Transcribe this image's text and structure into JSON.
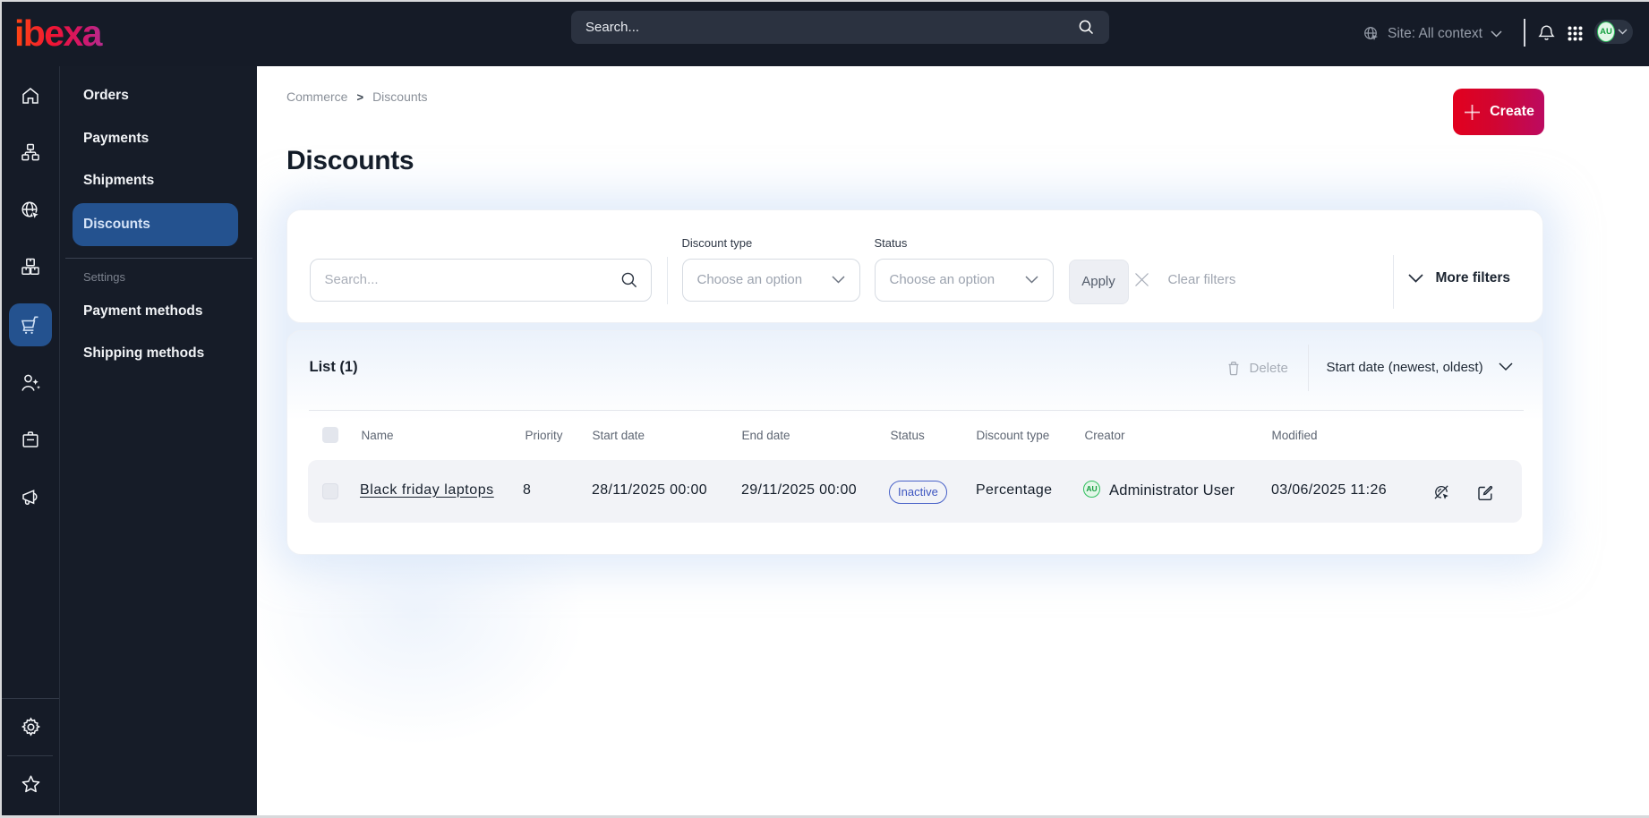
{
  "topbar": {
    "logo_text": "ibexa",
    "search_placeholder": "Search...",
    "site_context_label": "Site: All context",
    "avatar_initials": "AU"
  },
  "icon_rail": {
    "items": [
      {
        "name": "dashboard"
      },
      {
        "name": "content"
      },
      {
        "name": "site"
      },
      {
        "name": "products"
      },
      {
        "name": "commerce",
        "active": true
      },
      {
        "name": "customers"
      },
      {
        "name": "corporate"
      },
      {
        "name": "marketing"
      },
      {
        "name": "admin"
      },
      {
        "name": "bookmarks"
      }
    ]
  },
  "sidebar": {
    "items": [
      {
        "label": "Orders",
        "active": false
      },
      {
        "label": "Payments",
        "active": false
      },
      {
        "label": "Shipments",
        "active": false
      },
      {
        "label": "Discounts",
        "active": true
      }
    ],
    "section_label": "Settings",
    "section_items": [
      {
        "label": "Payment methods"
      },
      {
        "label": "Shipping methods"
      }
    ]
  },
  "breadcrumb": {
    "items": [
      "Commerce",
      "Discounts"
    ],
    "separator": ">"
  },
  "page": {
    "title": "Discounts"
  },
  "actions": {
    "create_label": "Create"
  },
  "filters": {
    "search_placeholder": "Search...",
    "discount_type_label": "Discount type",
    "discount_type_value": "Choose an option",
    "status_label": "Status",
    "status_value": "Choose an option",
    "apply_label": "Apply",
    "clear_label": "Clear filters",
    "more_filters_label": "More filters"
  },
  "list": {
    "title": "List (1)",
    "delete_label": "Delete",
    "sort_label": "Start date (newest, oldest)",
    "columns": [
      "Name",
      "Priority",
      "Start date",
      "End date",
      "Status",
      "Discount type",
      "Creator",
      "Modified"
    ],
    "rows": [
      {
        "name": "Black friday laptops",
        "priority": "8",
        "start_date": "28/11/2025 00:00",
        "end_date": "29/11/2025 00:00",
        "status": "Inactive",
        "discount_type": "Percentage",
        "creator": "Administrator User",
        "creator_initials": "AU",
        "modified": "03/06/2025 11:26"
      }
    ]
  },
  "colors": {
    "topbar_bg": "#151b27",
    "active_blue": "#24528f",
    "brand_gradient_start": "#e2001e",
    "brand_gradient_end": "#bc0a60",
    "status_inactive": "#3d55c0",
    "avatar_green": "#2fbf5e"
  }
}
